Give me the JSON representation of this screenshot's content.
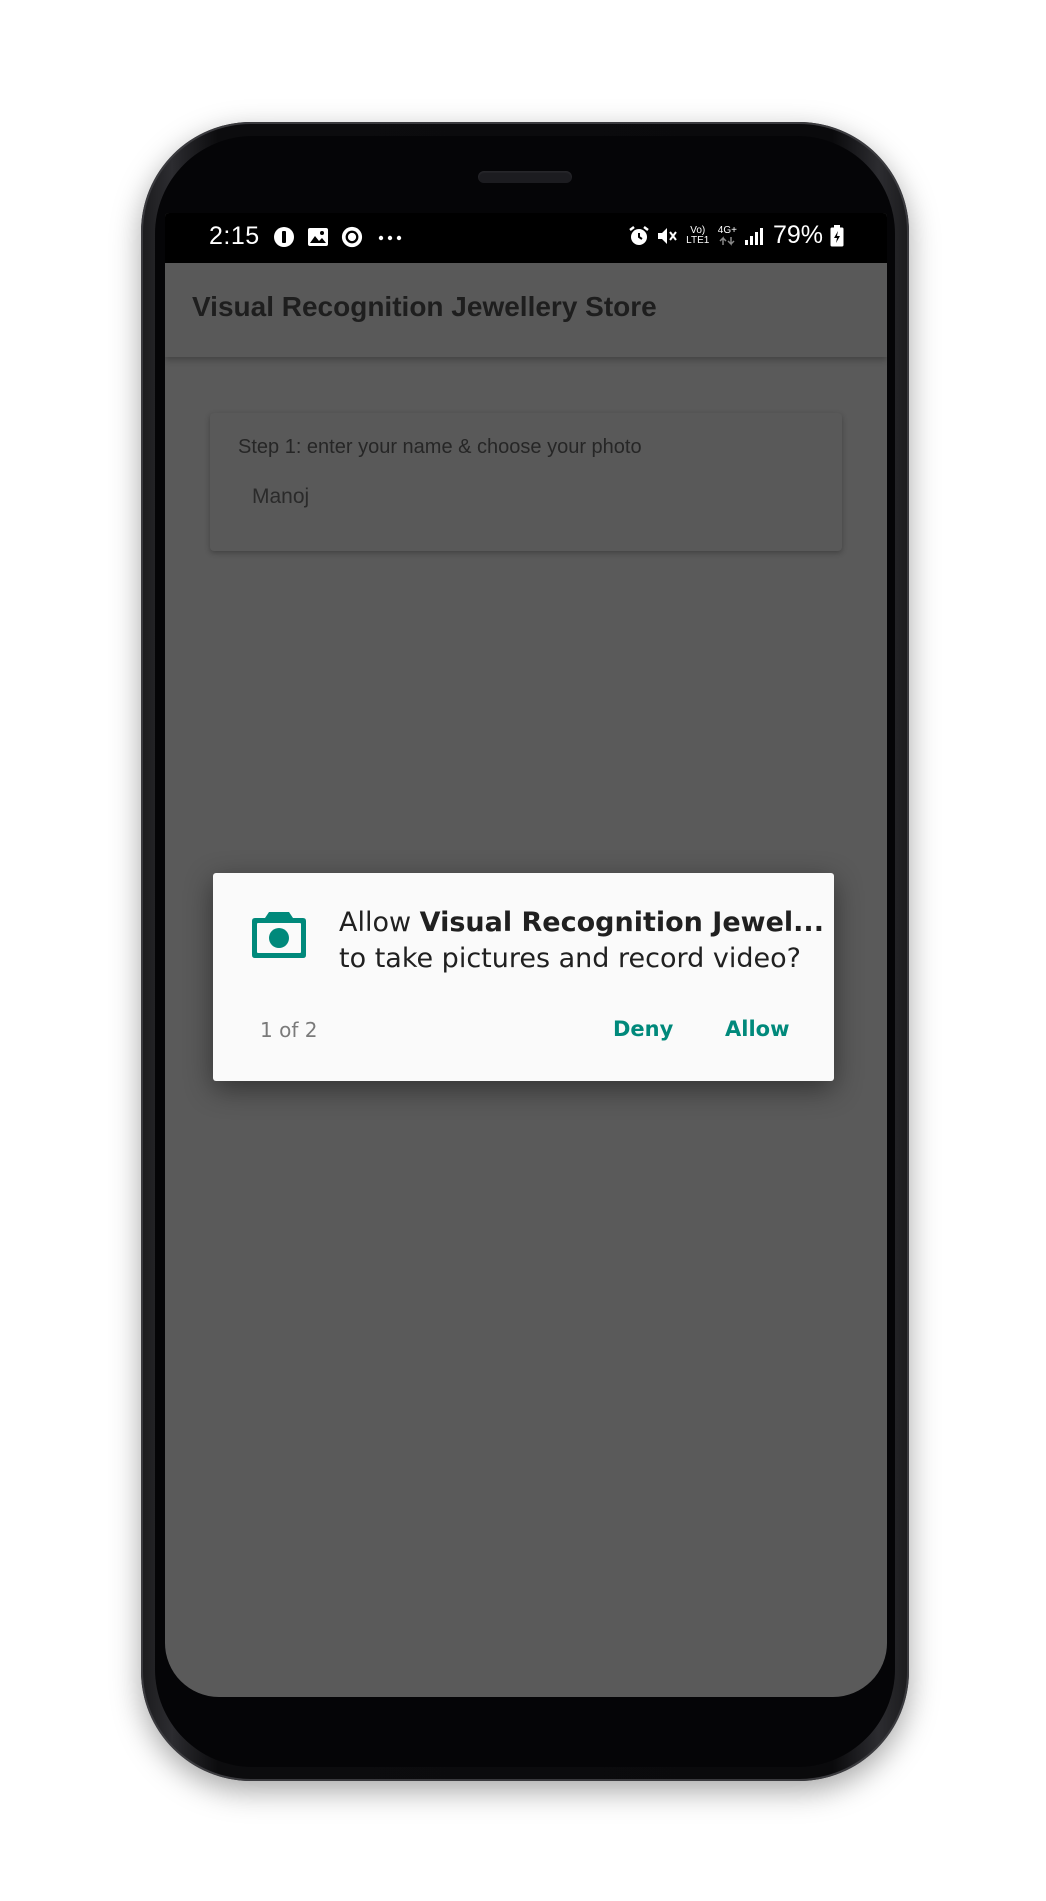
{
  "status_bar": {
    "time": "2:15",
    "battery_percent": "79%",
    "network_volte_label": "Vo) LTE1",
    "network_type_label": "4G+",
    "left_icons": [
      "info-circle-icon",
      "image-icon",
      "record-icon",
      "more-dots-icon"
    ],
    "right_icons": [
      "alarm-icon",
      "mute-icon",
      "volte-icon",
      "data-arrows-icon",
      "signal-icon",
      "battery-charging-icon"
    ]
  },
  "app_bar": {
    "title": "Visual Recognition Jewellery Store"
  },
  "card": {
    "heading": "Step 1: enter your name & choose your photo",
    "name_value": "Manoj"
  },
  "permission_dialog": {
    "icon": "camera-icon",
    "prefix": "Allow ",
    "app_name": "Visual Recognition Jewel...",
    "request": "to take pictures and record video?",
    "counter": "1 of 2",
    "deny_label": "Deny",
    "allow_label": "Allow",
    "accent_color": "#00897b"
  },
  "colors": {
    "scrim": "#5a5a5a",
    "dialog_bg": "#fafafa",
    "accent": "#00897b"
  }
}
